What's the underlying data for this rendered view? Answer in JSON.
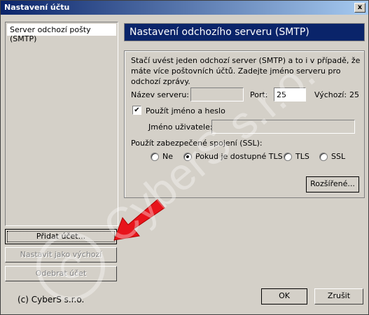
{
  "window": {
    "title": "Nastavení účtu",
    "close_glyph": "x"
  },
  "accounts": {
    "items": [
      "Server odchozí pošty (SMTP)"
    ],
    "add_button": "Přidat účet...",
    "set_default_button": "Nastavit jako výchozí",
    "remove_button": "Odebrat účet"
  },
  "copyright": "(c) CyberS s.r.o.",
  "smtp": {
    "heading": "Nastavení odchozího serveru (SMTP)",
    "description": "Stačí uvést jeden odchozí server (SMTP) a to i v případě, že máte více poštovních účtů. Zadejte jméno serveru pro odchozí zprávy.",
    "server_name_label": "Název serveru:",
    "server_name_value": "",
    "port_label": "Port:",
    "port_value": "25",
    "default_label": "Výchozí:",
    "default_value": "25",
    "use_auth_label": "Použít jméno a heslo",
    "use_auth_checked": true,
    "username_label": "Jméno uživatele:",
    "username_value": "",
    "ssl_label": "Použít zabezpečené spojení (SSL):",
    "ssl_options": [
      "Ne",
      "Pokud je dostupné TLS",
      "TLS",
      "SSL"
    ],
    "ssl_selected": "Pokud je dostupné TLS",
    "advanced_button": "Rozšířené..."
  },
  "footer": {
    "ok_button": "OK",
    "cancel_button": "Zrušit"
  },
  "watermark_text": "CyberS s.r.o.",
  "colors": {
    "title_gradient_start": "#0a246a",
    "heading_bg": "#0a246a",
    "arrow": "#e8141b",
    "dialog_bg": "#d4d0c8"
  }
}
